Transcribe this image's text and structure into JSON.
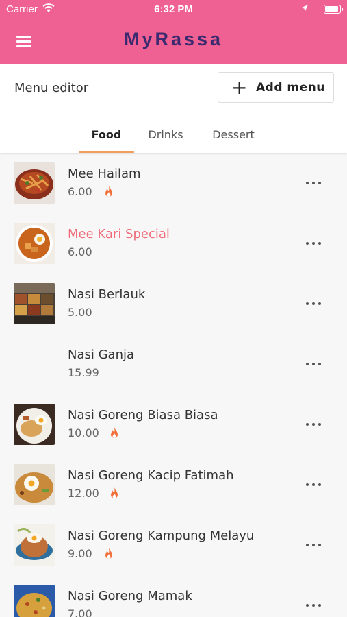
{
  "status_bar": {
    "carrier": "Carrier",
    "time": "6:32 PM"
  },
  "header": {
    "title": "MyRassa",
    "menu_icon": "hamburger-icon"
  },
  "colors": {
    "header": "#ef6192",
    "title": "#3b2a6f",
    "tab_indicator": "#f0a05b",
    "strikethrough": "#ef6c7a",
    "fire": "#f36f3a"
  },
  "editor": {
    "title": "Menu editor",
    "add_button_label": "Add menu"
  },
  "tabs": [
    {
      "label": "Food",
      "active": true
    },
    {
      "label": "Drinks",
      "active": false
    },
    {
      "label": "Dessert",
      "active": false
    }
  ],
  "items": [
    {
      "name": "Mee Hailam",
      "price": "6.00",
      "popular": true,
      "unavailable": false,
      "has_image": true
    },
    {
      "name": "Mee Kari Special",
      "price": "6.00",
      "popular": false,
      "unavailable": true,
      "has_image": true
    },
    {
      "name": "Nasi Berlauk",
      "price": "5.00",
      "popular": false,
      "unavailable": false,
      "has_image": true
    },
    {
      "name": "Nasi Ganja",
      "price": "15.99",
      "popular": false,
      "unavailable": false,
      "has_image": false
    },
    {
      "name": "Nasi Goreng Biasa Biasa",
      "price": "10.00",
      "popular": true,
      "unavailable": false,
      "has_image": true
    },
    {
      "name": "Nasi Goreng Kacip Fatimah",
      "price": "12.00",
      "popular": true,
      "unavailable": false,
      "has_image": true
    },
    {
      "name": "Nasi Goreng Kampung Melayu",
      "price": "9.00",
      "popular": true,
      "unavailable": false,
      "has_image": true
    },
    {
      "name": "Nasi Goreng Mamak",
      "price": "7.00",
      "popular": false,
      "unavailable": false,
      "has_image": true
    }
  ]
}
